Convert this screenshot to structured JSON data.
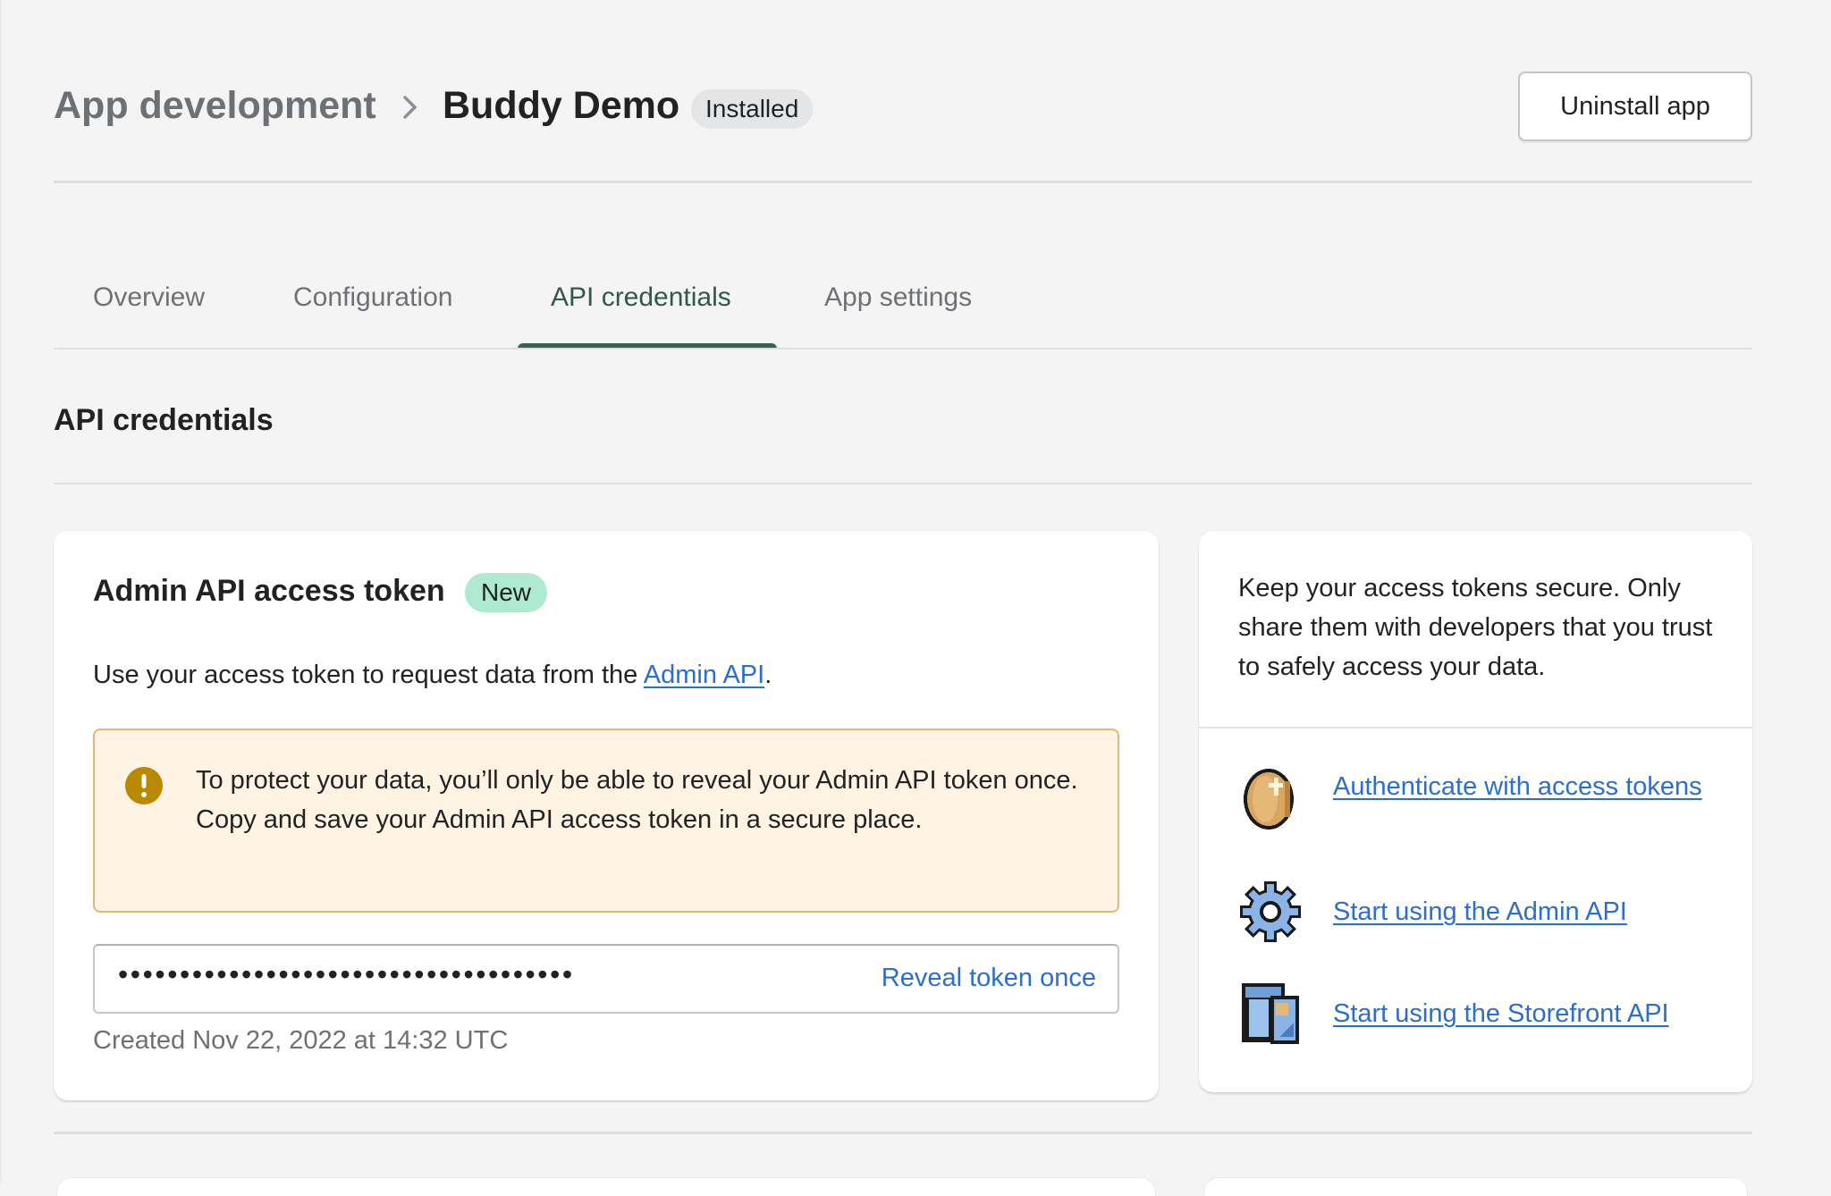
{
  "header": {
    "breadcrumb_parent": "App development",
    "title": "Buddy Demo",
    "status_badge": "Installed",
    "uninstall_label": "Uninstall app"
  },
  "tabs": [
    {
      "label": "Overview",
      "active": false
    },
    {
      "label": "Configuration",
      "active": false
    },
    {
      "label": "API credentials",
      "active": true
    },
    {
      "label": "App settings",
      "active": false
    }
  ],
  "section": {
    "title": "API credentials"
  },
  "admin_token_card": {
    "title": "Admin API access token",
    "badge": "New",
    "description_prefix": "Use your access token to request data from the ",
    "description_link": "Admin API",
    "description_suffix": ".",
    "warning": "To protect your data, you’ll only be able to reveal your Admin API token once. Copy and save your Admin API access token in a secure place.",
    "token_masked": "•••••••••••••••••••••••••••••••••••••",
    "reveal_label": "Reveal token once",
    "created": "Created Nov 22, 2022 at 14:32 UTC"
  },
  "info_card": {
    "text": "Keep your access tokens secure. Only share them with developers that you trust to safely access your data.",
    "resources": [
      {
        "icon": "coin-icon",
        "label": "Authenticate with access tokens"
      },
      {
        "icon": "gear-icon",
        "label": "Start using the Admin API"
      },
      {
        "icon": "storefront-icon",
        "label": "Start using the Storefront API"
      }
    ]
  },
  "colors": {
    "accent_tab": "#3c6052",
    "link": "#2c6ecb",
    "new_badge": "#aee9d1",
    "installed_badge": "#e4e5e7",
    "warning_bg": "#fff4e4",
    "warning_border": "#e1b878",
    "warning_icon": "#b98900"
  }
}
